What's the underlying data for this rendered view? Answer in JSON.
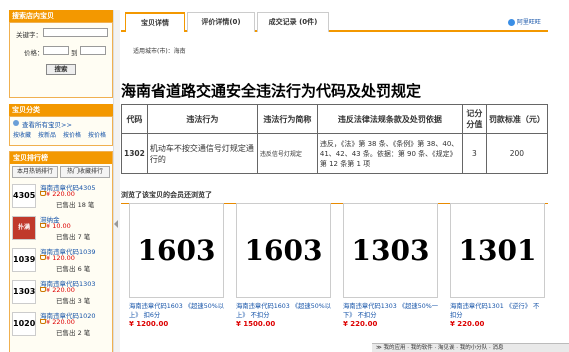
{
  "left": {
    "search_header": "搜索店内宝贝",
    "keyword_label": "关键字：",
    "price_label": "价格：",
    "to_label": "到",
    "search_button": "搜索",
    "category_header": "宝贝分类",
    "all_items_link": "查看所有宝贝>>",
    "sort_links": [
      "按收藏",
      "按新品",
      "按价格",
      "按价格"
    ],
    "rank_header": "宝贝排行榜",
    "rank_tabs": [
      "本月热销排行",
      "热门收藏排行"
    ],
    "rank_items": [
      {
        "thumb": "4305",
        "title": "海南违章代码4305",
        "price": "¥ 220.00",
        "sold": "已售出 18 笔"
      },
      {
        "thumb": "扑满",
        "title": "滞纳金",
        "price": "¥ 10.00",
        "sold": "已售出 7 笔"
      },
      {
        "thumb": "1039",
        "title": "海南违章代码1039",
        "price": "¥ 120.00",
        "sold": "已售出 6 笔"
      },
      {
        "thumb": "1303",
        "title": "海南违章代码1303",
        "price": "¥ 220.00",
        "sold": "已售出 3 笔"
      },
      {
        "thumb": "1020",
        "title": "海南违章代码1020",
        "price": "¥ 220.00",
        "sold": "已售出 2 笔"
      }
    ]
  },
  "main": {
    "tabs": [
      "宝贝详情",
      "评价详情(0)",
      "成交记录 (0件)"
    ],
    "logo_text": "阿里旺旺",
    "city_line": "适用城市(市)：海南",
    "title": "海南省道路交通安全违法行为代码及处罚规定",
    "table_headers": [
      "代码",
      "违法行为",
      "违法行为简称",
      "违反法律法规条款及处罚依据",
      "记分分值",
      "罚款标准（元）"
    ],
    "table_row": [
      "1302",
      "机动车不按交通信号灯规定通行的",
      "违反信号灯规定",
      "违反，《法》第 38 条、《条例》第 38、40、41、42、43 条。依据：第 90 条、《规定》第 12 条第 1 项",
      "3",
      "200"
    ],
    "also_header": "浏览了该宝贝的会员还浏览了",
    "cards": [
      {
        "img": "1603",
        "title": "海南违章代码1603 《超速50%以上》 扣6分",
        "price": "¥ 1200.00"
      },
      {
        "img": "1603",
        "title": "海南违章代码1603 《超速50%以上》 不扣分",
        "price": "¥ 1500.00"
      },
      {
        "img": "1303",
        "title": "海南违章代码1303 《超速50%一下》 不扣分",
        "price": "¥ 220.00"
      },
      {
        "img": "1301",
        "title": "海南违章代码1301 《逆行》 不扣分",
        "price": "¥ 220.00"
      }
    ]
  },
  "bottom_bar": "≫ 我的应用 · 我的软件 · 淘见诶 · 我的小分队 · 消息"
}
